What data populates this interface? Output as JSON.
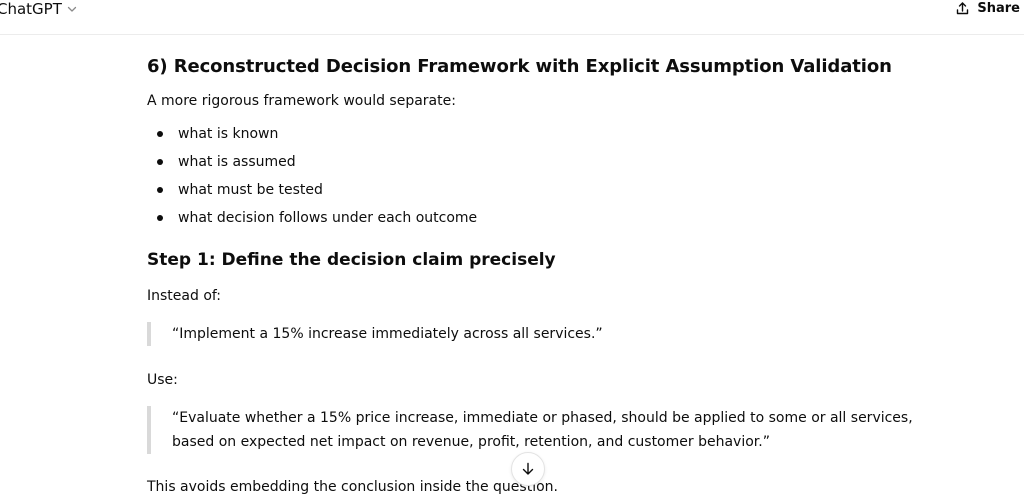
{
  "header": {
    "app_title": "ChatGPT",
    "share_label": "Share",
    "icons": [
      "chevron-down-icon",
      "share-icon"
    ]
  },
  "message": {
    "section_title": "6) Reconstructed Decision Framework with Explicit Assumption Validation",
    "intro": "A more rigorous framework would separate:",
    "bullets": [
      "what is known",
      "what is assumed",
      "what must be tested",
      "what decision follows under each outcome"
    ],
    "step_title": "Step 1: Define the decision claim precisely",
    "instead_label": "Instead of:",
    "quote_instead": "“Implement a 15% increase immediately across all services.”",
    "use_label": "Use:",
    "quote_use": {
      "line1": "“Evaluate whether a 15% price increase, immediate or phased, should be applied to some or all services,",
      "line2": "based on expected net impact on revenue, profit, retention, and customer behavior.”"
    },
    "closing": "This avoids embedding the conclusion inside the question."
  },
  "controls": {
    "scroll_down_icon": "arrow-down-icon"
  }
}
